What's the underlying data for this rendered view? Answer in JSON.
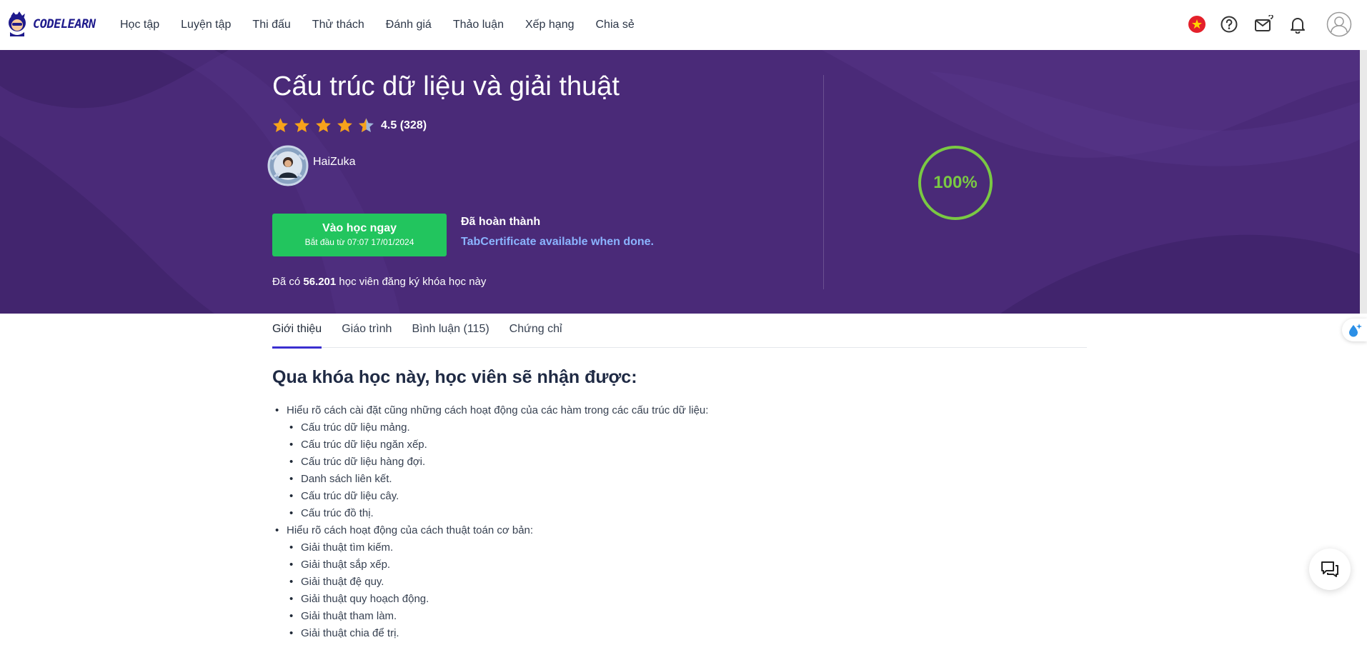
{
  "brand": {
    "logo_text": "CODELEARN"
  },
  "nav": {
    "items": [
      {
        "label": "Học tập"
      },
      {
        "label": "Luyện tập"
      },
      {
        "label": "Thi đấu"
      },
      {
        "label": "Thử thách"
      },
      {
        "label": "Đánh giá"
      },
      {
        "label": "Thảo luận"
      },
      {
        "label": "Xếp hạng"
      },
      {
        "label": "Chia sẻ"
      }
    ]
  },
  "header_icons": [
    "vietnam-flag-icon",
    "help-icon",
    "mail-icon",
    "bell-icon",
    "user-avatar-icon"
  ],
  "course": {
    "title": "Cấu trúc dữ liệu và giải thuật",
    "rating_value": 4.5,
    "rating_text": "4.5 (328)",
    "author": "HaiZuka",
    "cta_label": "Vào học ngay",
    "cta_sublabel": "Bắt đầu từ 07:07 17/01/2024",
    "status": "Đã hoàn thành",
    "certificate_link": "TabCertificate available when done.",
    "enroll_prefix": "Đã có",
    "enroll_count": "56.201",
    "enroll_suffix": "học viên đăng ký khóa học này",
    "progress": "100%"
  },
  "colors": {
    "banner": "#4a2a78",
    "cta": "#22c55e",
    "progress": "#7ac943",
    "link": "#8bb4ff",
    "tab_active": "#3b2fd0",
    "star": "#f7a21b"
  },
  "tabs": [
    {
      "label": "Giới thiệu",
      "active": true
    },
    {
      "label": "Giáo trình"
    },
    {
      "label": "Bình luận (115)"
    },
    {
      "label": "Chứng chỉ"
    }
  ],
  "intro": {
    "heading": "Qua khóa học này, học viên sẽ nhận được:",
    "groups": [
      {
        "text": "Hiểu rõ cách cài đặt cũng những cách hoạt động của các hàm trong các cấu trúc dữ liệu:",
        "items": [
          "Cấu trúc dữ liệu mảng.",
          "Cấu trúc dữ liệu ngăn xếp.",
          "Cấu trúc dữ liệu hàng đợi.",
          "Danh sách liên kết.",
          "Cấu trúc dữ liệu cây.",
          "Cấu trúc đồ thị."
        ]
      },
      {
        "text": "Hiểu rõ cách hoạt động của cách thuật toán cơ bản:",
        "items": [
          "Giải thuật tìm kiếm.",
          "Giải thuật sắp xếp.",
          "Giải thuật đệ quy.",
          "Giải thuật quy hoạch động.",
          "Giải thuật tham làm.",
          "Giải thuật chia để trị."
        ]
      }
    ]
  }
}
